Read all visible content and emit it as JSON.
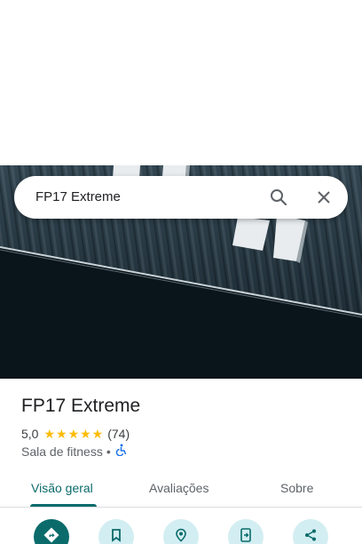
{
  "search": {
    "query": "FP17 Extreme"
  },
  "place": {
    "name": "FP17 Extreme",
    "rating_value": "5,0",
    "stars": "★★★★★",
    "review_count": "(74)",
    "category": "Sala de fitness",
    "separator": "•",
    "accessibility_icon": "wheelchair-icon"
  },
  "tabs": [
    {
      "label": "Visão geral",
      "active": true
    },
    {
      "label": "Avaliações",
      "active": false
    },
    {
      "label": "Sobre",
      "active": false
    }
  ],
  "actions": [
    {
      "icon": "directions-icon"
    },
    {
      "icon": "bookmark-icon"
    },
    {
      "icon": "nearby-pin-icon"
    },
    {
      "icon": "send-to-phone-icon"
    },
    {
      "icon": "share-icon"
    }
  ],
  "colors": {
    "accent": "#0b6b6b",
    "action_bg": "#d3eef2",
    "star": "#fbbc04",
    "accessibility": "#1a73e8"
  }
}
